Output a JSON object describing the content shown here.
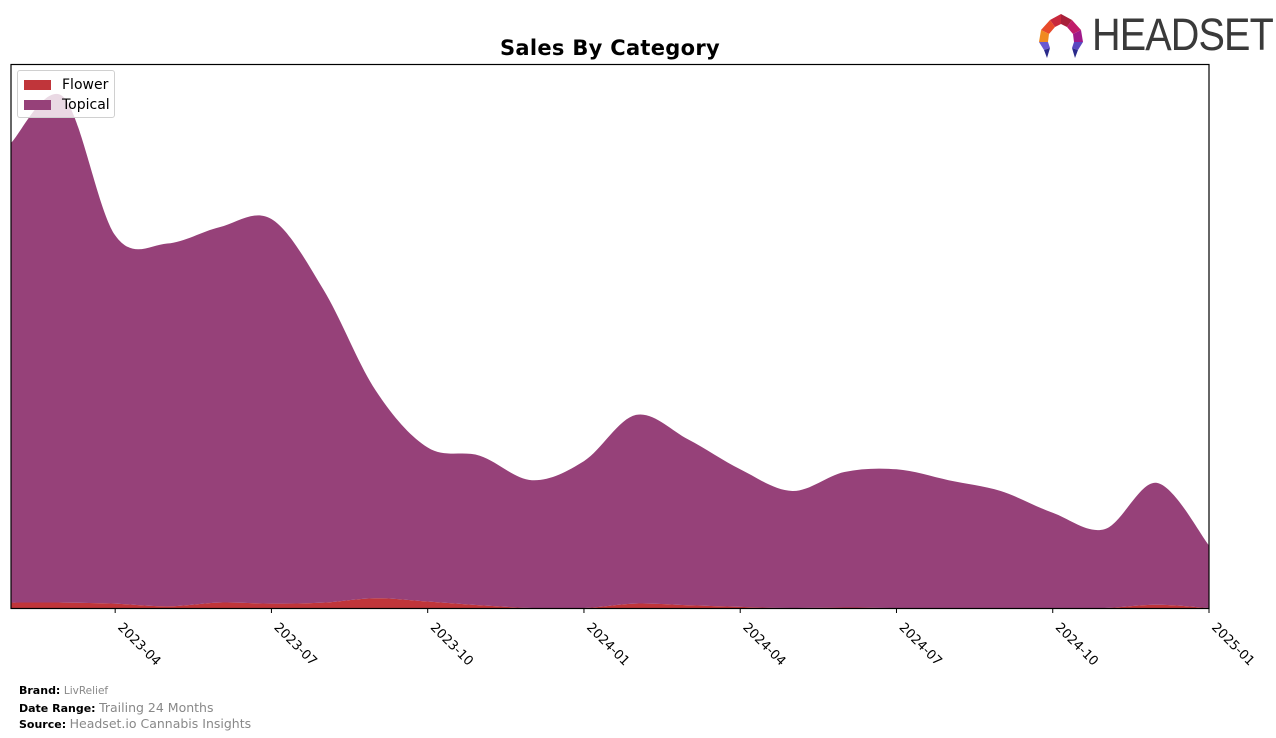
{
  "chart_data": {
    "type": "area",
    "stacked": true,
    "smoothed": true,
    "title": "Sales By Category",
    "xlabel": "",
    "ylabel": "",
    "y_ticks_visible": false,
    "grid": false,
    "legend_position": "top-left",
    "x": [
      "2023-02",
      "2023-03",
      "2023-04",
      "2023-05",
      "2023-06",
      "2023-07",
      "2023-08",
      "2023-09",
      "2023-10",
      "2023-11",
      "2023-12",
      "2024-01",
      "2024-02",
      "2024-03",
      "2024-04",
      "2024-05",
      "2024-06",
      "2024-07",
      "2024-08",
      "2024-09",
      "2024-10",
      "2024-11",
      "2024-12",
      "2025-01"
    ],
    "x_ticks": [
      "2023-04",
      "2023-07",
      "2023-10",
      "2024-01",
      "2024-04",
      "2024-07",
      "2024-10",
      "2025-01"
    ],
    "ylim": [
      0,
      100
    ],
    "series": [
      {
        "name": "Flower",
        "color": "#c0353a",
        "values": [
          1.0,
          1.0,
          0.8,
          0.3,
          1.0,
          0.8,
          1.0,
          1.8,
          1.2,
          0.5,
          0.0,
          0.0,
          0.8,
          0.5,
          0.2,
          0.0,
          0.1,
          0.0,
          0.0,
          0.0,
          0.0,
          0.0,
          0.6,
          0.0
        ]
      },
      {
        "name": "Topical",
        "color": "#964179",
        "values": [
          84.5,
          93.0,
          67.7,
          66.7,
          69.0,
          70.7,
          57.5,
          38.2,
          28.3,
          27.5,
          23.5,
          27.0,
          34.7,
          30.5,
          25.3,
          21.5,
          24.9,
          25.5,
          23.5,
          21.5,
          17.5,
          14.5,
          22.4,
          11.5
        ]
      }
    ]
  },
  "legend": {
    "items": [
      {
        "label": "Flower",
        "color": "#c0353a"
      },
      {
        "label": "Topical",
        "color": "#964179"
      }
    ]
  },
  "logo": {
    "text": "HEADSET"
  },
  "footer": {
    "brand_label": "Brand:",
    "brand_value": "LivRelief",
    "date_range_label": "Date Range:",
    "date_range_value": "Trailing 24 Months",
    "source_label": "Source:",
    "source_value": "Headset.io Cannabis Insights"
  }
}
